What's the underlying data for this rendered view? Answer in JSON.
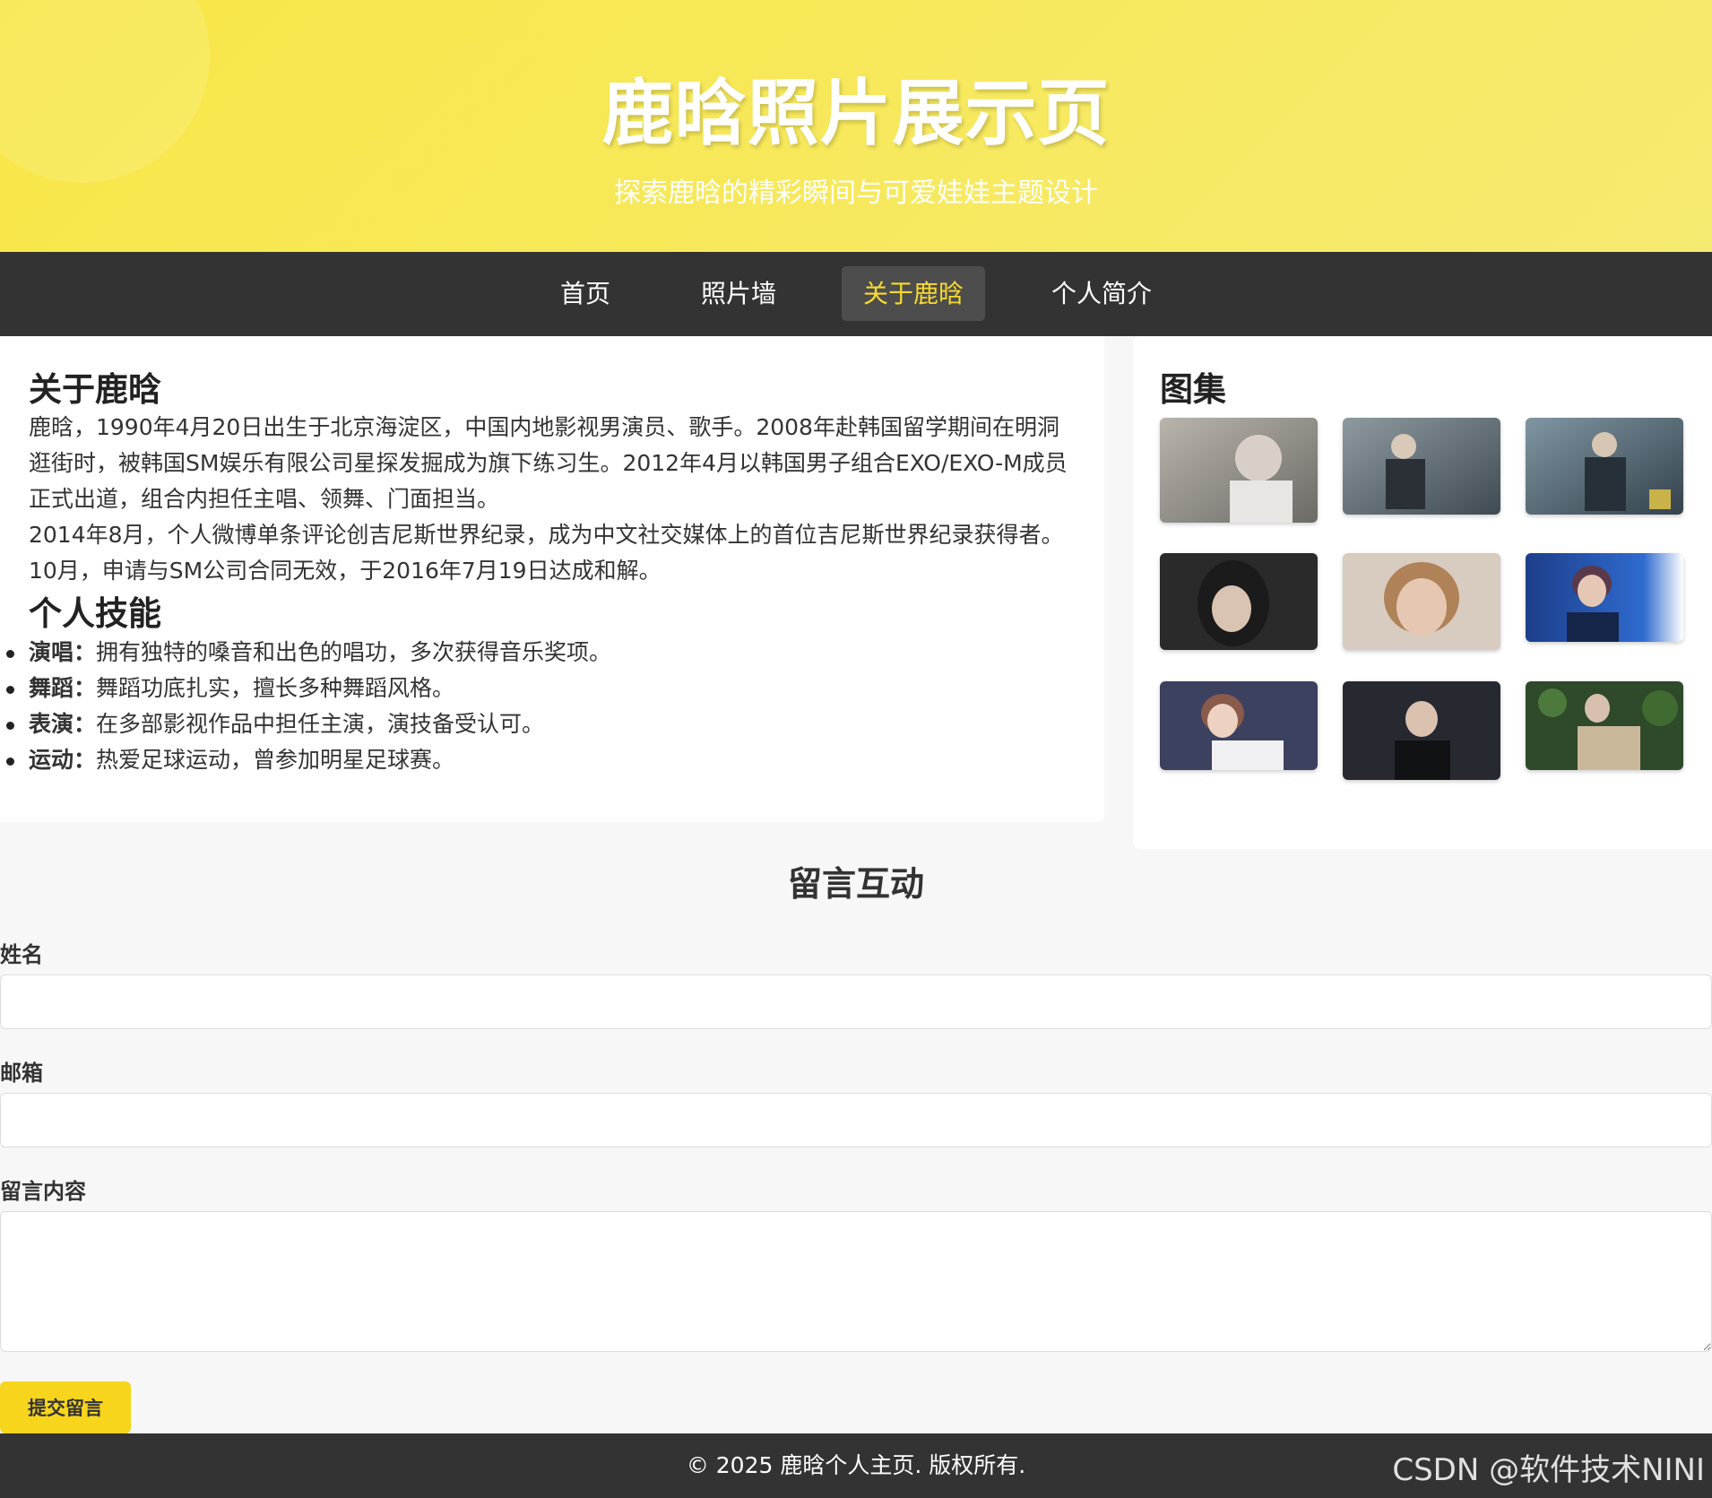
{
  "header": {
    "title": "鹿晗照片展示页",
    "subtitle": "探索鹿晗的精彩瞬间与可爱娃娃主题设计"
  },
  "nav": {
    "items": [
      {
        "label": "首页"
      },
      {
        "label": "照片墙"
      },
      {
        "label": "关于鹿晗"
      },
      {
        "label": "个人简介"
      }
    ],
    "active_index": 2
  },
  "about": {
    "heading": "关于鹿晗",
    "paragraph1": "鹿晗，1990年4月20日出生于北京海淀区，中国内地影视男演员、歌手。2008年赴韩国留学期间在明洞逛街时，被韩国SM娱乐有限公司星探发掘成为旗下练习生。2012年4月以韩国男子组合EXO/EXO-M成员正式出道，组合内担任主唱、领舞、门面担当。",
    "paragraph2": "2014年8月，个人微博单条评论创吉尼斯世界纪录，成为中文社交媒体上的首位吉尼斯世界纪录获得者。10月，申请与SM公司合同无效，于2016年7月19日达成和解。",
    "skills_heading": "个人技能",
    "skills": [
      {
        "name": "演唱：",
        "desc": "拥有独特的嗓音和出色的唱功，多次获得音乐奖项。"
      },
      {
        "name": "舞蹈：",
        "desc": "舞蹈功底扎实，擅长多种舞蹈风格。"
      },
      {
        "name": "表演：",
        "desc": "在多部影视作品中担任主演，演技备受认可。"
      },
      {
        "name": "运动：",
        "desc": "热爱足球运动，曾参加明星足球赛。"
      }
    ]
  },
  "gallery": {
    "heading": "图集"
  },
  "form": {
    "title": "留言互动",
    "name_label": "姓名",
    "email_label": "邮箱",
    "message_label": "留言内容",
    "submit_label": "提交留言"
  },
  "footer": {
    "text": "© 2025 鹿晗个人主页. 版权所有.",
    "watermark": "CSDN @软件技术NINI"
  },
  "colors": {
    "header_gradient_start": "#f8e646",
    "header_gradient_end": "#f6eb72",
    "nav_bg": "#333333",
    "nav_active_text": "#f7d931",
    "button_bg": "#f7d51d"
  }
}
